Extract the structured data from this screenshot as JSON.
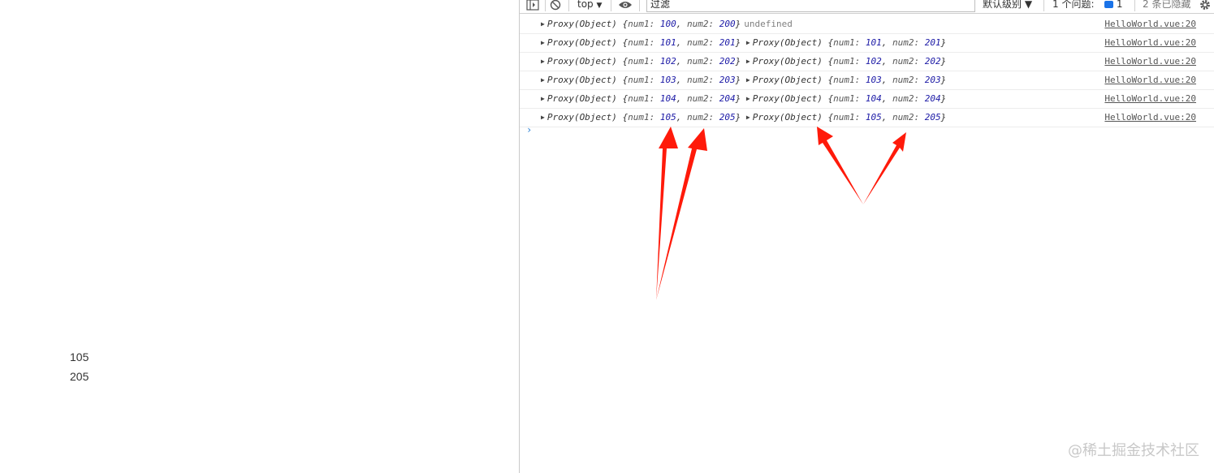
{
  "page": {
    "value1": "105",
    "value2": "205"
  },
  "toolbar": {
    "context": "top",
    "context_arrow": "▼",
    "filter_value": "过滤",
    "levels": "默认级别 ▼",
    "issues_label": "1 个问题:",
    "issues_count": "1",
    "hidden_label": "2 条已隐藏",
    "icons": [
      "sidebar-toggle-icon",
      "clear-console-icon",
      "eye-icon",
      "gear-icon"
    ]
  },
  "console": {
    "rows": [
      {
        "prefix": "Proxy(Object) ",
        "n1": "100",
        "n2": "200",
        "second": null,
        "tail": "undefined",
        "source": "HelloWorld.vue:20"
      },
      {
        "prefix": "Proxy(Object) ",
        "n1": "101",
        "n2": "201",
        "second": {
          "n1": "101",
          "n2": "201"
        },
        "tail": null,
        "source": "HelloWorld.vue:20"
      },
      {
        "prefix": "Proxy(Object) ",
        "n1": "102",
        "n2": "202",
        "second": {
          "n1": "102",
          "n2": "202"
        },
        "tail": null,
        "source": "HelloWorld.vue:20"
      },
      {
        "prefix": "Proxy(Object) ",
        "n1": "103",
        "n2": "203",
        "second": {
          "n1": "103",
          "n2": "203"
        },
        "tail": null,
        "source": "HelloWorld.vue:20"
      },
      {
        "prefix": "Proxy(Object) ",
        "n1": "104",
        "n2": "204",
        "second": {
          "n1": "104",
          "n2": "204"
        },
        "tail": null,
        "source": "HelloWorld.vue:20"
      },
      {
        "prefix": "Proxy(Object) ",
        "n1": "105",
        "n2": "205",
        "second": {
          "n1": "105",
          "n2": "205"
        },
        "tail": null,
        "source": "HelloWorld.vue:20"
      }
    ],
    "prompt": "›"
  },
  "watermark": "@稀土掘金技术社区",
  "colors": {
    "annotation_arrow": "#ff1a0a",
    "number": "#1c1aa6",
    "prompt": "#2a7fd4"
  }
}
